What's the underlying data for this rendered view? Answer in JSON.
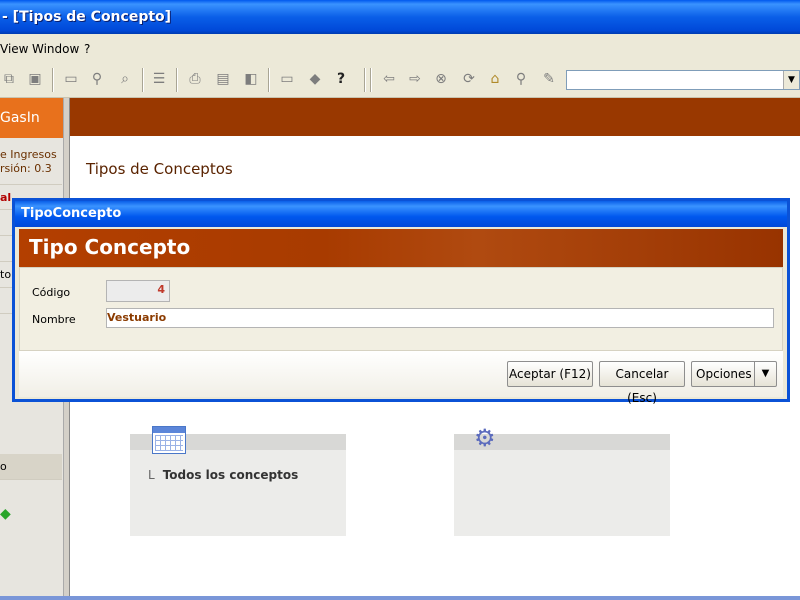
{
  "window": {
    "title": "- [Tipos de Concepto]"
  },
  "menu": {
    "items": [
      "View",
      "Window",
      "?"
    ]
  },
  "toolbar": {
    "combo_value": ""
  },
  "sidebar": {
    "brand": "GasIn",
    "app_line1": "e Ingresos",
    "app_line2": "rsión: 0.3",
    "section": "al",
    "row_label_1": "to",
    "row_label_2": "o"
  },
  "main": {
    "page_title": "Tipos de Conceptos",
    "card1_link": "Todos los conceptos",
    "card1_bullet": "L"
  },
  "dialog": {
    "window_title": "TipoConcepto",
    "header": "Tipo Concepto",
    "code_label": "Código",
    "code_value": "4",
    "name_label": "Nombre",
    "name_value": "Vestuario",
    "accept_label": "Aceptar (F12)",
    "cancel_label": "Cancelar (Esc)",
    "options_label": "Opciones"
  },
  "colors": {
    "accent": "#993800",
    "titlebar": "#0058ee",
    "brand": "#e8711c"
  }
}
